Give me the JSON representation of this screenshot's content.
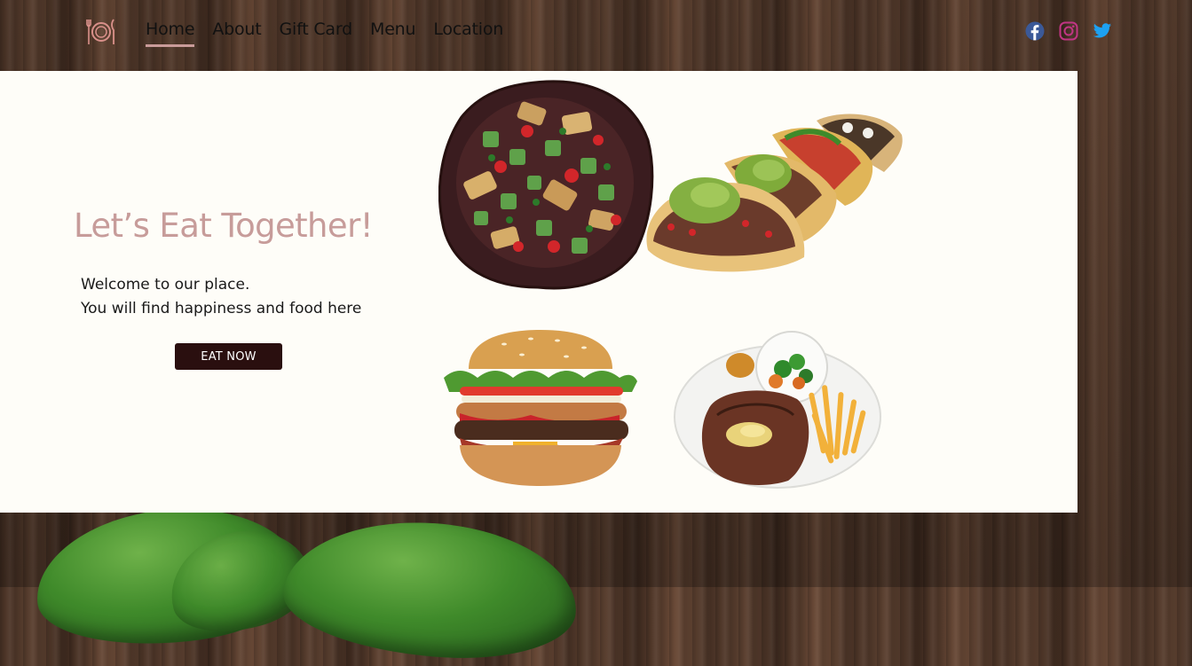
{
  "nav": {
    "logo_icon": "plate-fork-knife-icon",
    "items": [
      {
        "label": "Home",
        "active": true
      },
      {
        "label": "About",
        "active": false
      },
      {
        "label": "Gift Card",
        "active": false
      },
      {
        "label": "Menu",
        "active": false
      },
      {
        "label": "Location",
        "active": false
      }
    ],
    "social": [
      {
        "icon": "facebook-icon",
        "color": "#3b5998"
      },
      {
        "icon": "instagram-icon",
        "color": "#c13584"
      },
      {
        "icon": "twitter-icon",
        "color": "#1da1f2"
      }
    ]
  },
  "hero": {
    "title": "Let’s Eat Together!",
    "welcome_line1": "Welcome to our place.",
    "welcome_line2": "You will find happiness and food here",
    "cta_label": "EAT NOW"
  },
  "images": [
    "salad-image",
    "tacos-image",
    "burger-image",
    "steak-image"
  ],
  "colors": {
    "accent": "#c79c9a",
    "button": "#2a0f0f",
    "panel": "#fefdf8"
  }
}
